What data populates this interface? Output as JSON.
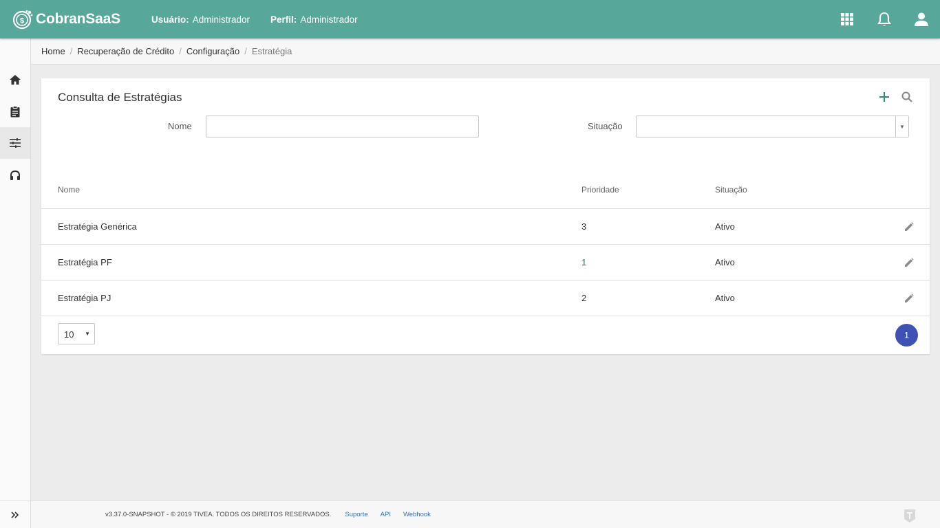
{
  "header": {
    "app_name": "CobranSaaS",
    "user_label": "Usuário:",
    "user_value": "Administrador",
    "profile_label": "Perfil:",
    "profile_value": "Administrador",
    "icons": [
      "apps-grid-icon",
      "notifications-bell-icon",
      "account-icon"
    ]
  },
  "sidebar": {
    "items": [
      {
        "icon": "home-icon"
      },
      {
        "icon": "clipboard-icon"
      },
      {
        "icon": "sliders-icon",
        "active": true
      },
      {
        "icon": "headset-icon"
      }
    ],
    "expand_icon": "double-chevron-right-icon"
  },
  "breadcrumb": {
    "items": [
      "Home",
      "Recuperação de Crédito",
      "Configuração"
    ],
    "current": "Estratégia"
  },
  "page": {
    "title": "Consulta de Estratégias",
    "filters": {
      "nome_label": "Nome",
      "nome_value": "",
      "situacao_label": "Situação",
      "situacao_value": ""
    },
    "table": {
      "columns": [
        "Nome",
        "Prioridade",
        "Situação"
      ],
      "rows": [
        {
          "nome": "Estratégia Genérica",
          "prioridade": "3",
          "situacao": "Ativo"
        },
        {
          "nome": "Estratégia PF",
          "prioridade": "1",
          "situacao": "Ativo"
        },
        {
          "nome": "Estratégia PJ",
          "prioridade": "2",
          "situacao": "Ativo"
        }
      ]
    },
    "pagination": {
      "page_size": "10",
      "current_page": "1"
    }
  },
  "footer": {
    "copyright": "v3.37.0-SNAPSHOT - © 2019 TIVEA. TODOS OS DIREITOS RESERVADOS.",
    "links": [
      "Suporte",
      "API",
      "Webhook"
    ]
  },
  "colors": {
    "topbar": "#57a89a",
    "pagination_active": "#3f51b5",
    "link": "#3a6fb0"
  }
}
